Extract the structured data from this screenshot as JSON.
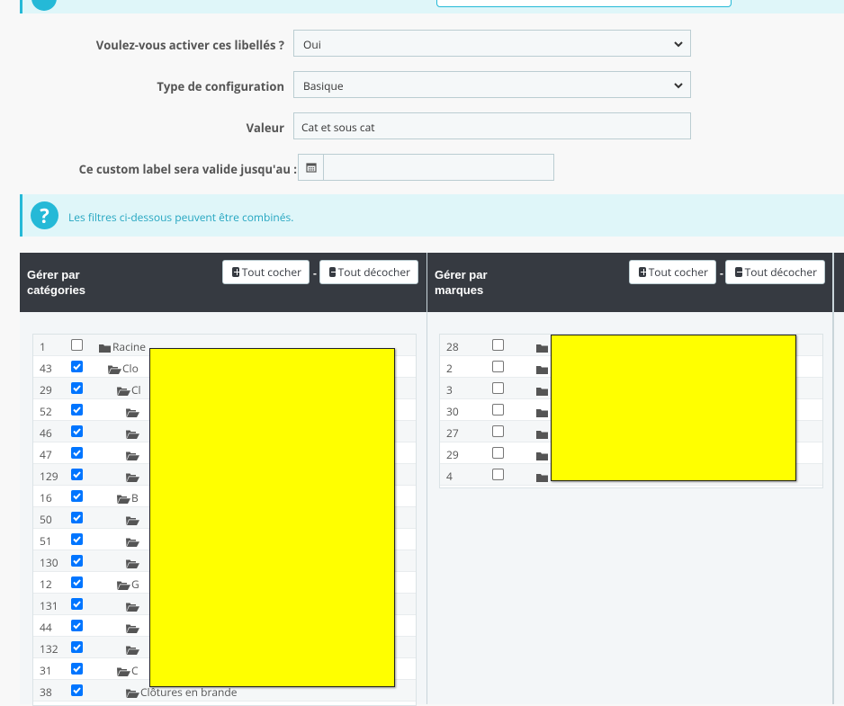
{
  "form": {
    "activate_label": "Voulez-vous activer ces libellés ?",
    "activate_value": "Oui",
    "config_label": "Type de configuration",
    "config_value": "Basique",
    "value_label": "Valeur",
    "value_value": "Cat et sous cat",
    "valid_until_label": "Ce custom label sera valide jusqu'au :",
    "valid_until_value": ""
  },
  "info": {
    "text": "Les filtres ci-dessous peuvent être combinés."
  },
  "categories_panel": {
    "title_line1": "Gérer par",
    "title_line2": "catégories",
    "check_all": "Tout cocher",
    "separator": "-",
    "uncheck_all": "Tout décocher",
    "rows": [
      {
        "id": "1",
        "checked": false,
        "name": "Racine",
        "depth": 0
      },
      {
        "id": "43",
        "checked": true,
        "name": "Clo",
        "depth": 1
      },
      {
        "id": "29",
        "checked": true,
        "name": "Cl",
        "depth": 2
      },
      {
        "id": "52",
        "checked": true,
        "name": "",
        "depth": 3
      },
      {
        "id": "46",
        "checked": true,
        "name": "",
        "depth": 3
      },
      {
        "id": "47",
        "checked": true,
        "name": "",
        "depth": 3
      },
      {
        "id": "129",
        "checked": true,
        "name": "",
        "depth": 3
      },
      {
        "id": "16",
        "checked": true,
        "name": "B",
        "depth": 2
      },
      {
        "id": "50",
        "checked": true,
        "name": "",
        "depth": 3
      },
      {
        "id": "51",
        "checked": true,
        "name": "",
        "depth": 3
      },
      {
        "id": "130",
        "checked": true,
        "name": "",
        "depth": 3
      },
      {
        "id": "12",
        "checked": true,
        "name": "G",
        "depth": 2
      },
      {
        "id": "131",
        "checked": true,
        "name": "",
        "depth": 3
      },
      {
        "id": "44",
        "checked": true,
        "name": "",
        "depth": 3
      },
      {
        "id": "132",
        "checked": true,
        "name": "",
        "depth": 3
      },
      {
        "id": "31",
        "checked": true,
        "name": "C",
        "depth": 2
      },
      {
        "id": "38",
        "checked": true,
        "name": "Clôtures en brande",
        "depth": 3
      }
    ]
  },
  "brands_panel": {
    "title_line1": "Gérer par",
    "title_line2": "marques",
    "check_all": "Tout cocher",
    "separator": "-",
    "uncheck_all": "Tout décocher",
    "rows": [
      {
        "id": "28",
        "checked": false
      },
      {
        "id": "2",
        "checked": false
      },
      {
        "id": "3",
        "checked": false
      },
      {
        "id": "30",
        "checked": false
      },
      {
        "id": "27",
        "checked": false
      },
      {
        "id": "29",
        "checked": false
      },
      {
        "id": "4",
        "checked": false
      }
    ]
  },
  "colors": {
    "accent": "#25b9d7",
    "panel_header": "#363a41",
    "redaction": "#ffff00",
    "checkbox": "#0075ff"
  }
}
